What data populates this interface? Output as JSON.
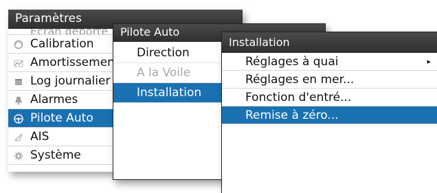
{
  "panels": {
    "parametres": {
      "title": "Paramètres",
      "cut_item": "Ecran déporté",
      "items": [
        {
          "label": "Calibration",
          "icon": "calibration-icon"
        },
        {
          "label": "Amortissement",
          "icon": "damping-icon"
        },
        {
          "label": "Log journalier",
          "icon": "log-icon"
        },
        {
          "label": "Alarmes",
          "icon": "alarm-bell-icon"
        },
        {
          "label": "Pilote Auto",
          "icon": "steering-wheel-icon",
          "selected": true
        },
        {
          "label": "AIS",
          "icon": "ais-icon"
        },
        {
          "label": "Système",
          "icon": "gear-icon"
        }
      ]
    },
    "pilote_auto": {
      "title": "Pilote Auto",
      "items": [
        {
          "label": "Direction"
        },
        {
          "label": "A la Voile",
          "disabled": true
        },
        {
          "label": "Installation",
          "selected": true
        }
      ]
    },
    "installation": {
      "title": "Installation",
      "items": [
        {
          "label": "Réglages à quai",
          "submenu_arrow": "▸"
        },
        {
          "label": "Réglages en mer..."
        },
        {
          "label": "Fonction d'entré..."
        },
        {
          "label": "Remise à zéro...",
          "selected": true
        }
      ]
    }
  },
  "colors": {
    "title_bar": "#3a3a3a",
    "selected": "#1a71b2",
    "disabled_text": "#a8a8a8"
  }
}
